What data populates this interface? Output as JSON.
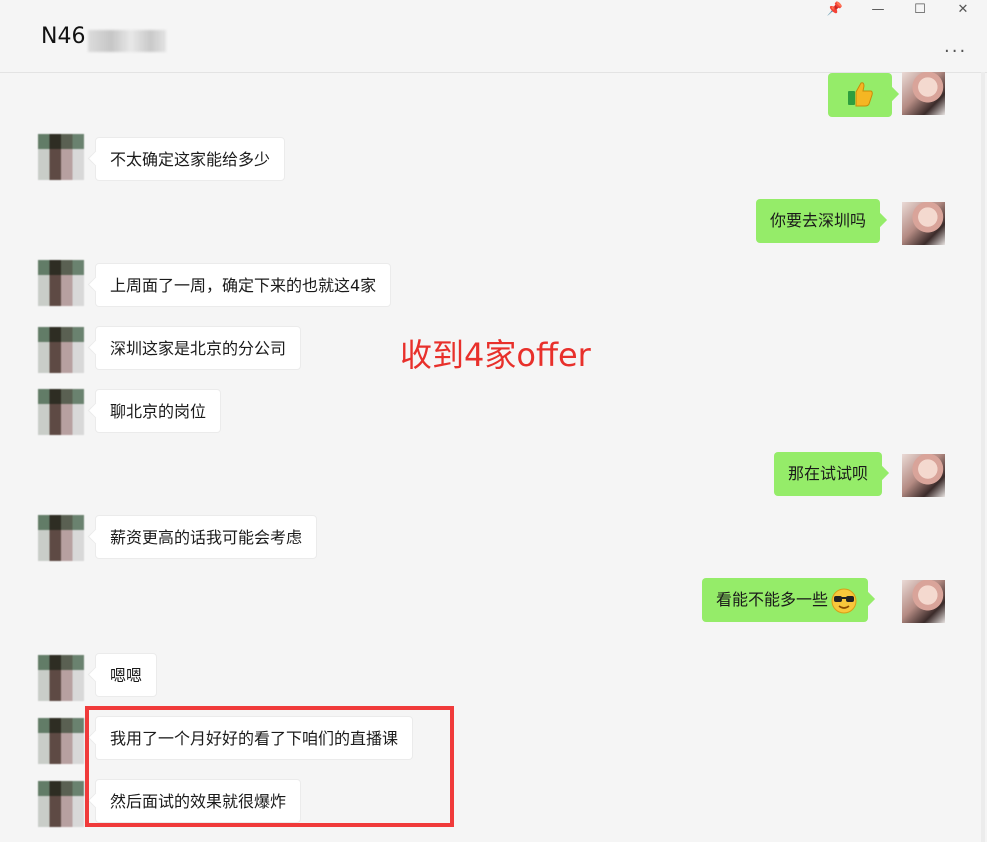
{
  "window": {
    "chat_title": "N46",
    "controls": {
      "pin": "📌",
      "minimize": "—",
      "maximize": "☐",
      "close": "✕"
    },
    "more_label": "..."
  },
  "messages": [
    {
      "side": "right",
      "type": "emoji",
      "emoji": "thumbs-up"
    },
    {
      "side": "left",
      "text": "不太确定这家能给多少"
    },
    {
      "side": "right",
      "text": "你要去深圳吗"
    },
    {
      "side": "left",
      "text": "上周面了一周，确定下来的也就这4家"
    },
    {
      "side": "left",
      "text": "深圳这家是北京的分公司"
    },
    {
      "side": "left",
      "text": "聊北京的岗位"
    },
    {
      "side": "right",
      "text": "那在试试呗"
    },
    {
      "side": "left",
      "text": "薪资更高的话我可能会考虑"
    },
    {
      "side": "right",
      "text": "看能不能多一些",
      "emoji": "sunglasses"
    },
    {
      "side": "left",
      "text": "嗯嗯"
    },
    {
      "side": "left",
      "text": "我用了一个月好好的看了下咱们的直播课"
    },
    {
      "side": "left",
      "text": "然后面试的效果就很爆炸"
    }
  ],
  "annotation": {
    "text": "收到4家offer",
    "color": "#e8302b"
  },
  "colors": {
    "right_bubble": "#95ec69",
    "left_bubble": "#ffffff",
    "highlight": "#f03a3a"
  }
}
